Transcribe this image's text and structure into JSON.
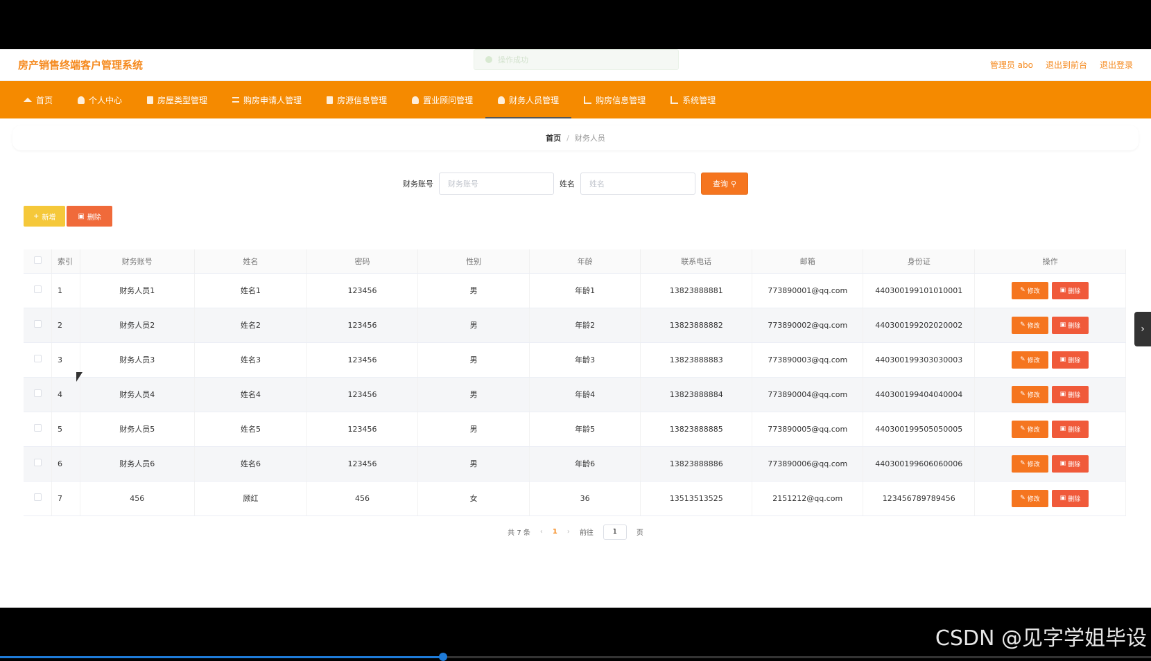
{
  "app": {
    "title": "房产销售终端客户管理系统",
    "toast": "操作成功",
    "admin_label": "管理员 abo",
    "back_front": "退出到前台",
    "logout": "退出登录"
  },
  "nav": [
    {
      "label": "首页",
      "icon": "home-icon"
    },
    {
      "label": "个人中心",
      "icon": "user-icon"
    },
    {
      "label": "房屋类型管理",
      "icon": "box-icon"
    },
    {
      "label": "购房申请人管理",
      "icon": "list-icon"
    },
    {
      "label": "房源信息管理",
      "icon": "box-icon"
    },
    {
      "label": "置业顾问管理",
      "icon": "user-icon"
    },
    {
      "label": "财务人员管理",
      "icon": "user-icon",
      "active": true
    },
    {
      "label": "购房信息管理",
      "icon": "chart-icon"
    },
    {
      "label": "系统管理",
      "icon": "chart-icon"
    }
  ],
  "breadcrumb": {
    "home": "首页",
    "sep": "/",
    "current": "财务人员"
  },
  "search": {
    "account_label": "财务账号",
    "account_placeholder": "财务账号",
    "name_label": "姓名",
    "name_placeholder": "姓名",
    "query_label": "查询"
  },
  "actions": {
    "add": "新增",
    "delete": "删除"
  },
  "table": {
    "headers": [
      "索引",
      "财务账号",
      "姓名",
      "密码",
      "性别",
      "年龄",
      "联系电话",
      "邮箱",
      "身份证",
      "操作"
    ],
    "edit_label": "修改",
    "delete_label": "删除",
    "rows": [
      [
        "1",
        "财务人员1",
        "姓名1",
        "123456",
        "男",
        "年龄1",
        "13823888881",
        "773890001@qq.com",
        "440300199101010001"
      ],
      [
        "2",
        "财务人员2",
        "姓名2",
        "123456",
        "男",
        "年龄2",
        "13823888882",
        "773890002@qq.com",
        "440300199202020002"
      ],
      [
        "3",
        "财务人员3",
        "姓名3",
        "123456",
        "男",
        "年龄3",
        "13823888883",
        "773890003@qq.com",
        "440300199303030003"
      ],
      [
        "4",
        "财务人员4",
        "姓名4",
        "123456",
        "男",
        "年龄4",
        "13823888884",
        "773890004@qq.com",
        "440300199404040004"
      ],
      [
        "5",
        "财务人员5",
        "姓名5",
        "123456",
        "男",
        "年龄5",
        "13823888885",
        "773890005@qq.com",
        "440300199505050005"
      ],
      [
        "6",
        "财务人员6",
        "姓名6",
        "123456",
        "男",
        "年龄6",
        "13823888886",
        "773890006@qq.com",
        "440300199606060006"
      ],
      [
        "7",
        "456",
        "顾红",
        "456",
        "女",
        "36",
        "13513513525",
        "2151212@qq.com",
        "123456789789456"
      ]
    ]
  },
  "pager": {
    "total": "共 7 条",
    "current": "1",
    "goto": "前往",
    "page_value": "1",
    "page_unit": "页"
  },
  "watermark": "CSDN @见字学姐毕设",
  "video_progress": 0.385,
  "colors": {
    "accent": "#f58a00",
    "query": "#f5751f",
    "add": "#f5c83a",
    "delete": "#f06a3a"
  }
}
